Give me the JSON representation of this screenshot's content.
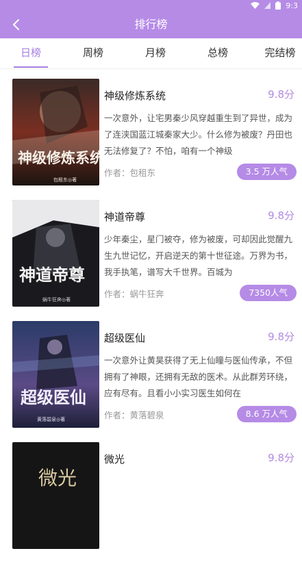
{
  "status_bar": {
    "time": "9:3"
  },
  "header": {
    "title": "排行榜"
  },
  "tabs": [
    {
      "label": "日榜"
    },
    {
      "label": "周榜"
    },
    {
      "label": "月榜"
    },
    {
      "label": "总榜"
    },
    {
      "label": "完结榜"
    }
  ],
  "books": [
    {
      "title": "神级修炼系统",
      "score": "9.8分",
      "description": "一次意外，让宅男秦少风穿越重生到了异世，成为了连浃国蓝江城秦家大少。什么修为被废？丹田也无法修复了？不怕，咱有一个神级",
      "author_label": "作者：",
      "author": "包租东",
      "popularity": "3.5 万人气",
      "cover_text": "神级修炼系统",
      "cover_caption": "包租东◎著"
    },
    {
      "title": "神道帝尊",
      "score": "9.8分",
      "description": "少年秦尘，星门被夺，修为被废，可却因此觉醒九生九世记忆，开启逆天的第十世征途。万界为书，我手执笔，谱写大千世界。百城为",
      "author_label": "作者：",
      "author": "蜗牛狂奔",
      "popularity": "7350人气",
      "cover_text": "神道帝尊",
      "cover_caption": "蜗牛狂奔◎著"
    },
    {
      "title": "超级医仙",
      "score": "9.8分",
      "description": "一次意外让黄昊获得了无上仙瞳与医仙传承，不但拥有了神眼，还拥有无敌的医术。从此群芳环绕，应有尽有。且看小小实习医生如何在",
      "author_label": "作者：",
      "author": "黄落碧泉",
      "popularity": "8.6 万人气",
      "cover_text": "超级医仙",
      "cover_caption": "黄落碧泉◎著"
    },
    {
      "title": "微光",
      "score": "9.8分",
      "description": "",
      "author_label": "",
      "author": "",
      "popularity": "",
      "cover_text": "微光",
      "cover_caption": ""
    }
  ],
  "colors": {
    "accent": "#b58be6",
    "accent_text": "#a67ee0"
  },
  "icons": {
    "back": "chevron-left-icon",
    "wifi": "wifi-icon",
    "battery": "battery-icon"
  }
}
